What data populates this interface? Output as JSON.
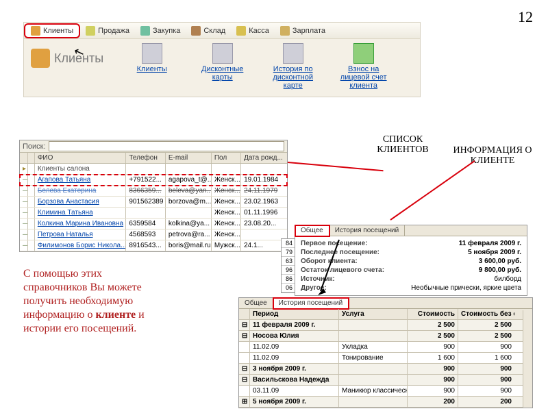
{
  "page_number": "12",
  "toolbar": {
    "items": [
      "Клиенты",
      "Продажа",
      "Закупка",
      "Склад",
      "Касса",
      "Зарплата"
    ],
    "section_title": "Клиенты",
    "actions": {
      "clients": "Клиенты",
      "discount": "Дисконтные карты",
      "history": "История по дисконтной карте",
      "deposit": "Взнос на лицевой счет клиента"
    }
  },
  "labels": {
    "clients_list": "СПИСОК КЛИЕНТОВ",
    "client_info": "ИНФОРМАЦИЯ О КЛИЕНТЕ",
    "search": "Поиск:"
  },
  "client_columns": [
    "",
    "",
    "ФИО",
    "Телефон",
    "E-mail",
    "Пол",
    "Дата рожд..."
  ],
  "client_group": "Клиенты салона",
  "clients": [
    {
      "fio": "Агапова Татьяна",
      "tel": "+791522...",
      "mail": "agapova_t@...",
      "sex": "Женск...",
      "dob": "19.01.1984",
      "sel": true
    },
    {
      "fio": "Белева Екатерина",
      "tel": "8366359...",
      "mail": "beleva@yan...",
      "sex": "Женск...",
      "dob": "24.11.1979",
      "strike": true
    },
    {
      "fio": "Борзова Анастасия",
      "tel": "901562389",
      "mail": "borzova@m...",
      "sex": "Женск...",
      "dob": "23.02.1963"
    },
    {
      "fio": "Климина Татьяна",
      "tel": "",
      "mail": "",
      "sex": "Женск...",
      "dob": "01.11.1996"
    },
    {
      "fio": "Колкина Марина Ивановна",
      "tel": "6359584",
      "mail": "kolkina@ya...",
      "sex": "Женск...",
      "dob": "23.08.20..."
    },
    {
      "fio": "Петрова Наталья",
      "tel": "4568593",
      "mail": "petrova@ra...",
      "sex": "Женск...",
      "dob": ""
    },
    {
      "fio": "Филимонов Борис Никола...",
      "tel": "8916543...",
      "mail": "boris@mail.ru",
      "sex": "Мужск...",
      "dob": "24.1..."
    }
  ],
  "info": {
    "tabs": [
      "Общее",
      "История посещений"
    ],
    "first_visit_k": "Первое посещение:",
    "first_visit_v": "11 февраля 2009 г.",
    "last_visit_k": "Последнее посещение:",
    "last_visit_v": "5 ноября 2009 г.",
    "turnover_k": "Оборот клиента:",
    "turnover_v": "3 600,00  руб.",
    "balance_k": "Остаток лицевого счета:",
    "balance_v": "9 800,00  руб.",
    "source_k": "Источник:",
    "source_v": "билборд",
    "other_k": "Другое:",
    "other_v": "Необычные прически, яркие цвета"
  },
  "ids": [
    "84",
    "79",
    "63",
    "96",
    "86",
    "06"
  ],
  "history": {
    "tabs": [
      "Общее",
      "История посещений"
    ],
    "columns": [
      "",
      "Период",
      "Услуга",
      "Стоимость",
      "Стоимость без скидок"
    ],
    "rows": [
      {
        "grp": true,
        "exp": "⊟",
        "per": "11 февраля 2009 г.",
        "srv": "",
        "c1": "2 500",
        "c2": "2 500"
      },
      {
        "grp": true,
        "exp": "⊟",
        "per": "Носова Юлия",
        "srv": "",
        "c1": "2 500",
        "c2": "2 500"
      },
      {
        "exp": "",
        "per": "11.02.09",
        "srv": "Укладка",
        "c1": "900",
        "c2": "900"
      },
      {
        "exp": "",
        "per": "11.02.09",
        "srv": "Тонирование",
        "c1": "1 600",
        "c2": "1 600"
      },
      {
        "grp": true,
        "exp": "⊟",
        "per": "3 ноября 2009 г.",
        "srv": "",
        "c1": "900",
        "c2": "900"
      },
      {
        "grp": true,
        "exp": "⊟",
        "per": "Васильскова Надежда",
        "srv": "",
        "c1": "900",
        "c2": "900"
      },
      {
        "exp": "",
        "per": "03.11.09",
        "srv": "Маникюр классически...",
        "c1": "900",
        "c2": "900"
      },
      {
        "grp": true,
        "exp": "⊞",
        "per": "5 ноября 2009 г.",
        "srv": "",
        "c1": "200",
        "c2": "200"
      }
    ]
  },
  "explain": {
    "p1": "С помощью этих справочников Вы можете получить необходимую информацию о ",
    "p2": "клиенте",
    "p3": " и истории его посещений."
  }
}
